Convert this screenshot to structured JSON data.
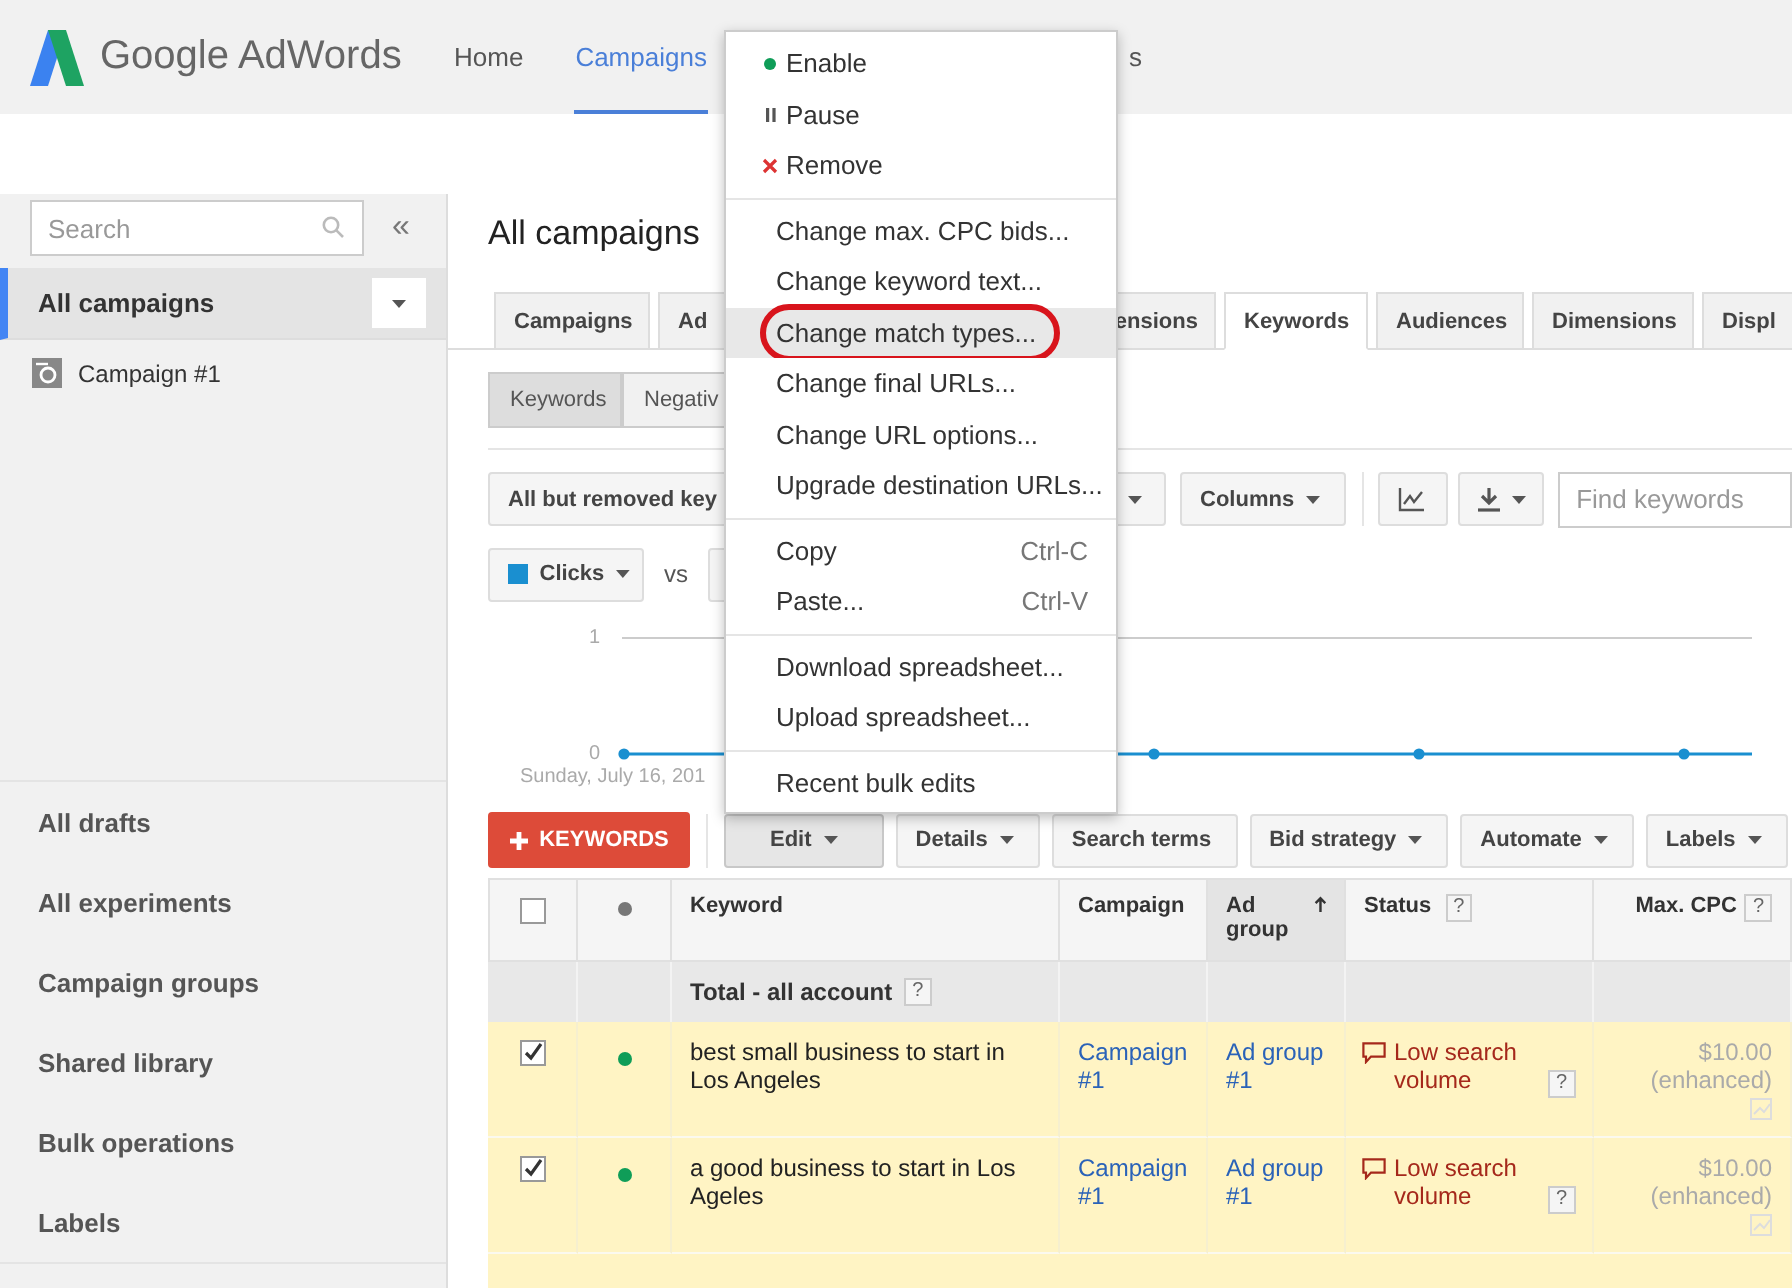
{
  "header": {
    "logo": "Google AdWords",
    "nav": [
      {
        "label": "Home",
        "selected": false
      },
      {
        "label": "Campaigns",
        "selected": true
      },
      {
        "label": "s",
        "selected": false
      }
    ]
  },
  "sidebar": {
    "search": {
      "placeholder": "Search"
    },
    "collapse": "«",
    "all_campaigns": {
      "label": "All campaigns",
      "selected": true
    },
    "campaigns": [
      {
        "label": "Campaign #1"
      }
    ],
    "links": [
      "All drafts",
      "All experiments",
      "Campaign groups",
      "Shared library",
      "Bulk operations",
      "Labels"
    ]
  },
  "page_title": "All campaigns",
  "tabs": [
    {
      "label": "Campaigns",
      "selected": false
    },
    {
      "label": "Ad",
      "selected": false
    },
    {
      "label": "ensions",
      "selected": false
    },
    {
      "label": "Keywords",
      "selected": true
    },
    {
      "label": "Audiences",
      "selected": false
    },
    {
      "label": "Dimensions",
      "selected": false
    },
    {
      "label": "Displ",
      "selected": false
    }
  ],
  "subtabs": [
    {
      "label": "Keywords",
      "selected": true
    },
    {
      "label": "Negativ",
      "selected": false
    }
  ],
  "toolbar": {
    "filter": "All but removed key",
    "columns": "Columns",
    "find": {
      "placeholder": "Find keywords"
    }
  },
  "metric": {
    "label": "Clicks",
    "color": "#1a8fd0",
    "vs": "vs"
  },
  "chart": {
    "tick_labels": [
      "1",
      "0"
    ],
    "date": "Sunday, July 16, 201"
  },
  "actions": {
    "add": "KEYWORDS",
    "buttons": [
      {
        "label": "Edit",
        "dropdown": true,
        "pressed": true
      },
      {
        "label": "Details",
        "dropdown": true,
        "pressed": false
      },
      {
        "label": "Search terms",
        "dropdown": false,
        "pressed": false
      },
      {
        "label": "Bid strategy",
        "dropdown": true,
        "pressed": false
      },
      {
        "label": "Automate",
        "dropdown": true,
        "pressed": false
      },
      {
        "label": "Labels",
        "dropdown": true,
        "pressed": false
      }
    ]
  },
  "table": {
    "select_all": {
      "checked": false
    },
    "columns": [
      {
        "label": "Keyword",
        "sorted": false
      },
      {
        "label": "Campaign",
        "sorted": false
      },
      {
        "label": "Ad group",
        "sorted": true
      },
      {
        "label": "Status",
        "sorted": false,
        "help": "?"
      },
      {
        "label": "Max. CPC",
        "sorted": false,
        "help": "?"
      }
    ],
    "total": {
      "label": "Total - all account",
      "help": "?"
    },
    "rows": [
      {
        "checked": true,
        "enabled": true,
        "keyword": "best small business to start in Los Angeles",
        "campaign": "Campaign #1",
        "ad_group": "Ad group #1",
        "status": "Low search volume",
        "status_help": "?",
        "max_cpc": "$10.00",
        "bid_note": "(enhanced)"
      },
      {
        "checked": true,
        "enabled": true,
        "keyword": "a good business to start in Los Ageles",
        "campaign": "Campaign #1",
        "ad_group": "Ad group #1",
        "status": "Low search volume",
        "status_help": "?",
        "max_cpc": "$10.00",
        "bid_note": "(enhanced)"
      }
    ]
  },
  "menu": {
    "groups": [
      [
        {
          "label": "Enable",
          "selected": false,
          "circled": false
        },
        {
          "label": "Pause",
          "selected": false,
          "circled": false
        },
        {
          "label": "Remove",
          "selected": false,
          "circled": false
        }
      ],
      [
        {
          "label": "Change max. CPC bids...",
          "selected": false,
          "circled": false
        },
        {
          "label": "Change keyword text...",
          "selected": false,
          "circled": false
        },
        {
          "label": "Change match types...",
          "selected": true,
          "circled": true
        },
        {
          "label": "Change final URLs...",
          "selected": false,
          "circled": false
        },
        {
          "label": "Change URL options...",
          "selected": false,
          "circled": false
        },
        {
          "label": "Upgrade destination URLs...",
          "selected": false,
          "circled": false
        }
      ],
      [
        {
          "label": "Copy",
          "shortcut": "Ctrl-C",
          "selected": false,
          "circled": false
        },
        {
          "label": "Paste...",
          "shortcut": "Ctrl-V",
          "selected": false,
          "circled": false
        }
      ],
      [
        {
          "label": "Download spreadsheet...",
          "selected": false,
          "circled": false
        },
        {
          "label": "Upload spreadsheet...",
          "selected": false,
          "circled": false
        }
      ],
      [
        {
          "label": "Recent bulk edits",
          "selected": false,
          "circled": false
        }
      ]
    ]
  }
}
